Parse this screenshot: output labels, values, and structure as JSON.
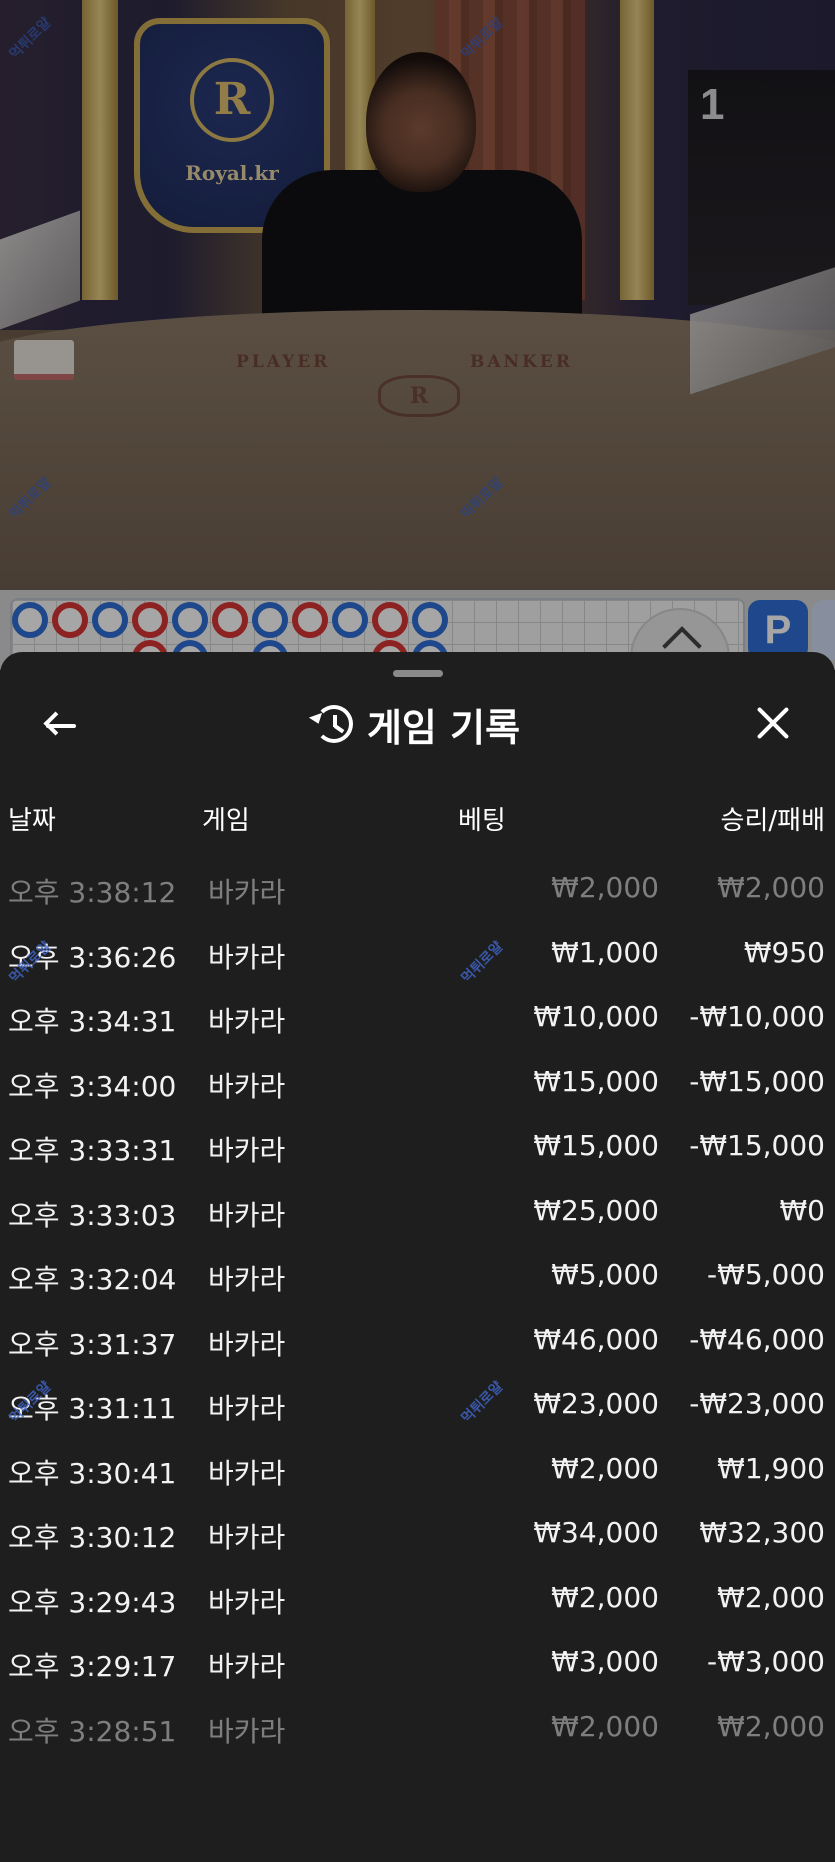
{
  "video": {
    "table_number": "1",
    "brand_name": "Royal.kr",
    "crest_letter": "R",
    "table_labels": {
      "player": "PLAYER",
      "banker": "BANKER"
    },
    "watermark": "먹튀로얄"
  },
  "roadmap": {
    "beads_top_row": [
      "P",
      "B",
      "P",
      "B",
      "P",
      "B",
      "P",
      "B",
      "P",
      "B",
      "P"
    ],
    "beads_second_row": [
      "B",
      "P",
      "P",
      "B",
      "P"
    ],
    "pair_badge": "P"
  },
  "sheet": {
    "title": "게임 기록",
    "columns": {
      "date": "날짜",
      "game": "게임",
      "bet": "베팅",
      "result": "승리/패배"
    },
    "rows": [
      {
        "time": "오후 3:38:12",
        "game": "바카라",
        "bet": "₩2,000",
        "result": "₩2,000"
      },
      {
        "time": "오후 3:36:26",
        "game": "바카라",
        "bet": "₩1,000",
        "result": "₩950"
      },
      {
        "time": "오후 3:34:31",
        "game": "바카라",
        "bet": "₩10,000",
        "result": "-₩10,000"
      },
      {
        "time": "오후 3:34:00",
        "game": "바카라",
        "bet": "₩15,000",
        "result": "-₩15,000"
      },
      {
        "time": "오후 3:33:31",
        "game": "바카라",
        "bet": "₩15,000",
        "result": "-₩15,000"
      },
      {
        "time": "오후 3:33:03",
        "game": "바카라",
        "bet": "₩25,000",
        "result": "₩0"
      },
      {
        "time": "오후 3:32:04",
        "game": "바카라",
        "bet": "₩5,000",
        "result": "-₩5,000"
      },
      {
        "time": "오후 3:31:37",
        "game": "바카라",
        "bet": "₩46,000",
        "result": "-₩46,000"
      },
      {
        "time": "오후 3:31:11",
        "game": "바카라",
        "bet": "₩23,000",
        "result": "-₩23,000"
      },
      {
        "time": "오후 3:30:41",
        "game": "바카라",
        "bet": "₩2,000",
        "result": "₩1,900"
      },
      {
        "time": "오후 3:30:12",
        "game": "바카라",
        "bet": "₩34,000",
        "result": "₩32,300"
      },
      {
        "time": "오후 3:29:43",
        "game": "바카라",
        "bet": "₩2,000",
        "result": "₩2,000"
      },
      {
        "time": "오후 3:29:17",
        "game": "바카라",
        "bet": "₩3,000",
        "result": "-₩3,000"
      },
      {
        "time": "오후 3:28:51",
        "game": "바카라",
        "bet": "₩2,000",
        "result": "₩2,000"
      }
    ]
  }
}
